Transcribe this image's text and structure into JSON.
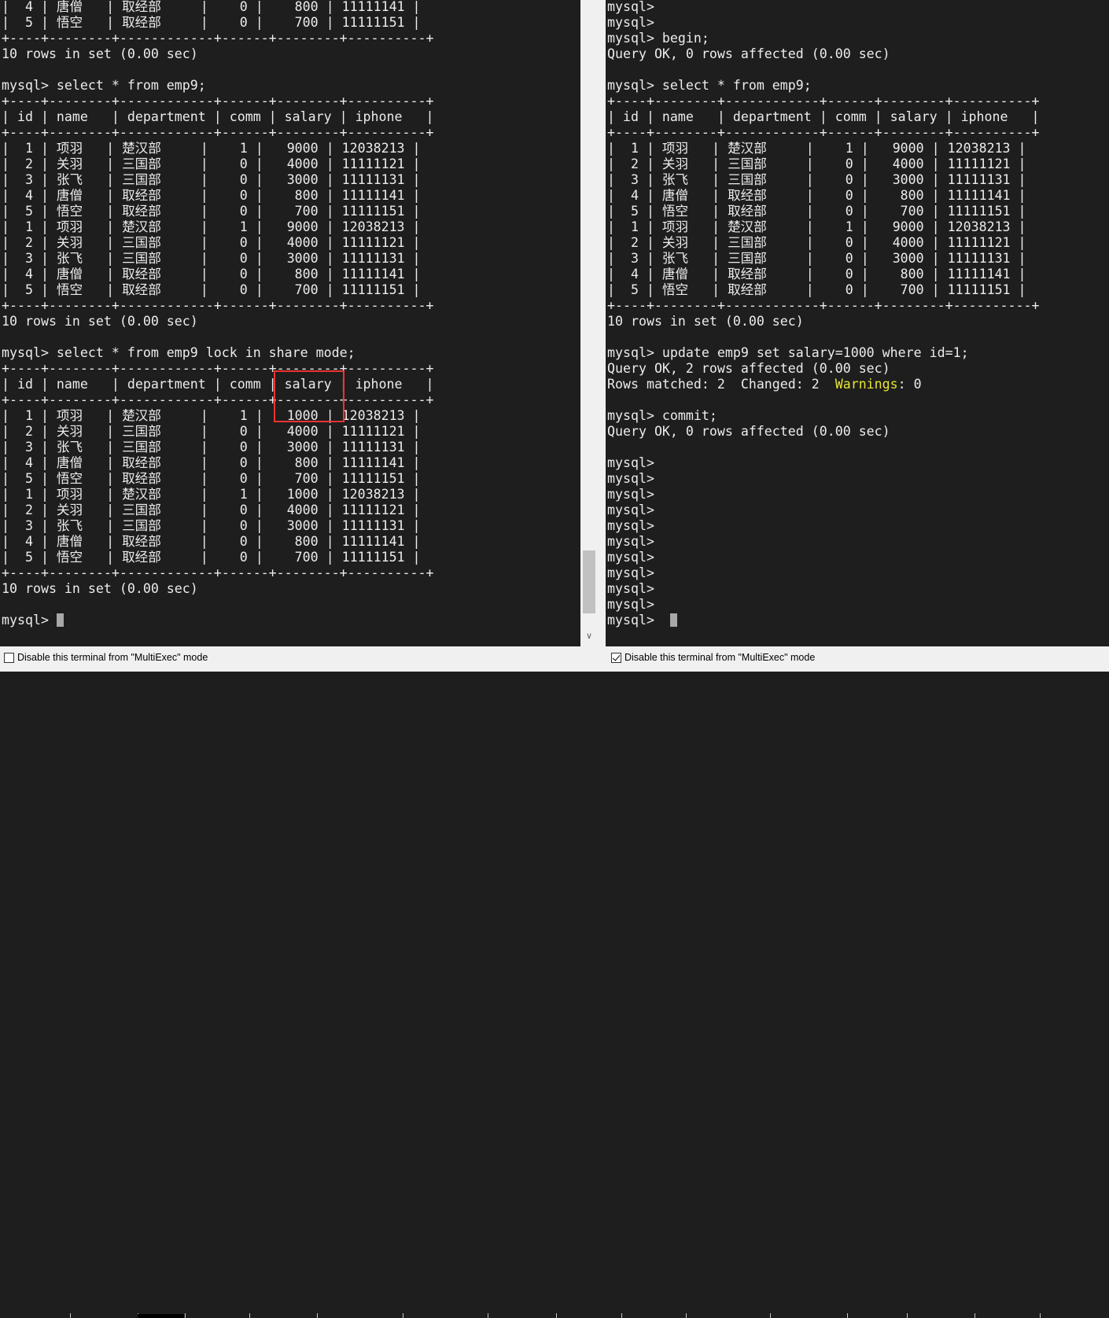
{
  "left_terminal": {
    "lines": [
      "|  4 | 唐僧   | 取经部     |    0 |    800 | 11111141 |",
      "|  5 | 悟空   | 取经部     |    0 |    700 | 11111151 |",
      "+----+--------+------------+------+--------+----------+",
      "10 rows in set (0.00 sec)",
      "",
      "mysql> select * from emp9;",
      "+----+--------+------------+------+--------+----------+",
      "| id | name   | department | comm | salary | iphone   |",
      "+----+--------+------------+------+--------+----------+",
      "|  1 | 项羽   | 楚汉部     |    1 |   9000 | 12038213 |",
      "|  2 | 关羽   | 三国部     |    0 |   4000 | 11111121 |",
      "|  3 | 张飞   | 三国部     |    0 |   3000 | 11111131 |",
      "|  4 | 唐僧   | 取经部     |    0 |    800 | 11111141 |",
      "|  5 | 悟空   | 取经部     |    0 |    700 | 11111151 |",
      "|  1 | 项羽   | 楚汉部     |    1 |   9000 | 12038213 |",
      "|  2 | 关羽   | 三国部     |    0 |   4000 | 11111121 |",
      "|  3 | 张飞   | 三国部     |    0 |   3000 | 11111131 |",
      "|  4 | 唐僧   | 取经部     |    0 |    800 | 11111141 |",
      "|  5 | 悟空   | 取经部     |    0 |    700 | 11111151 |",
      "+----+--------+------------+------+--------+----------+",
      "10 rows in set (0.00 sec)",
      "",
      "mysql> select * from emp9 lock in share mode;",
      "+----+--------+------------+------+--------+----------+",
      "| id | name   | department | comm | salary | iphone   |",
      "+----+--------+------------+------+--------+----------+",
      "|  1 | 项羽   | 楚汉部     |    1 |   1000 | 12038213 |",
      "|  2 | 关羽   | 三国部     |    0 |   4000 | 11111121 |",
      "|  3 | 张飞   | 三国部     |    0 |   3000 | 11111131 |",
      "|  4 | 唐僧   | 取经部     |    0 |    800 | 11111141 |",
      "|  5 | 悟空   | 取经部     |    0 |    700 | 11111151 |",
      "|  1 | 项羽   | 楚汉部     |    1 |   1000 | 12038213 |",
      "|  2 | 关羽   | 三国部     |    0 |   4000 | 11111121 |",
      "|  3 | 张飞   | 三国部     |    0 |   3000 | 11111131 |",
      "|  4 | 唐僧   | 取经部     |    0 |    800 | 11111141 |",
      "|  5 | 悟空   | 取经部     |    0 |    700 | 11111151 |",
      "+----+--------+------------+------+--------+----------+",
      "10 rows in set (0.00 sec)",
      ""
    ],
    "prompt": "mysql> "
  },
  "right_terminal": {
    "lines": [
      "mysql>",
      "mysql>",
      "mysql> begin;",
      "Query OK, 0 rows affected (0.00 sec)",
      "",
      "mysql> select * from emp9;",
      "+----+--------+------------+------+--------+----------+",
      "| id | name   | department | comm | salary | iphone   |",
      "+----+--------+------------+------+--------+----------+",
      "|  1 | 项羽   | 楚汉部     |    1 |   9000 | 12038213 |",
      "|  2 | 关羽   | 三国部     |    0 |   4000 | 11111121 |",
      "|  3 | 张飞   | 三国部     |    0 |   3000 | 11111131 |",
      "|  4 | 唐僧   | 取经部     |    0 |    800 | 11111141 |",
      "|  5 | 悟空   | 取经部     |    0 |    700 | 11111151 |",
      "|  1 | 项羽   | 楚汉部     |    1 |   9000 | 12038213 |",
      "|  2 | 关羽   | 三国部     |    0 |   4000 | 11111121 |",
      "|  3 | 张飞   | 三国部     |    0 |   3000 | 11111131 |",
      "|  4 | 唐僧   | 取经部     |    0 |    800 | 11111141 |",
      "|  5 | 悟空   | 取经部     |    0 |    700 | 11111151 |",
      "+----+--------+------------+------+--------+----------+",
      "10 rows in set (0.00 sec)",
      "",
      "mysql> update emp9 set salary=1000 where id=1;",
      "Query OK, 2 rows affected (0.00 sec)",
      "",
      "",
      "mysql> commit;",
      "Query OK, 0 rows affected (0.00 sec)",
      "",
      "mysql>",
      "mysql>",
      "mysql>",
      "mysql>",
      "mysql>",
      "mysql>",
      "mysql>",
      "mysql>",
      "mysql>",
      "mysql>"
    ],
    "warnings_line": {
      "prefix": "Rows matched: 2  Changed: 2  ",
      "highlight": "Warnings",
      "suffix": ": 0"
    },
    "prompt": "mysql>  "
  },
  "statusbar": {
    "left_checkbox_label": "Disable this terminal from \"MultiExec\" mode",
    "left_checked": false,
    "right_checkbox_label": "Disable this terminal from \"MultiExec\" mode",
    "right_checked": true
  },
  "colors": {
    "terminal_bg": "#1e1e1e",
    "terminal_fg": "#ececec",
    "warning_fg": "#e6e632",
    "highlight_box": "#e33333"
  },
  "icons": {
    "scroll_down": "chevron-down-icon"
  }
}
